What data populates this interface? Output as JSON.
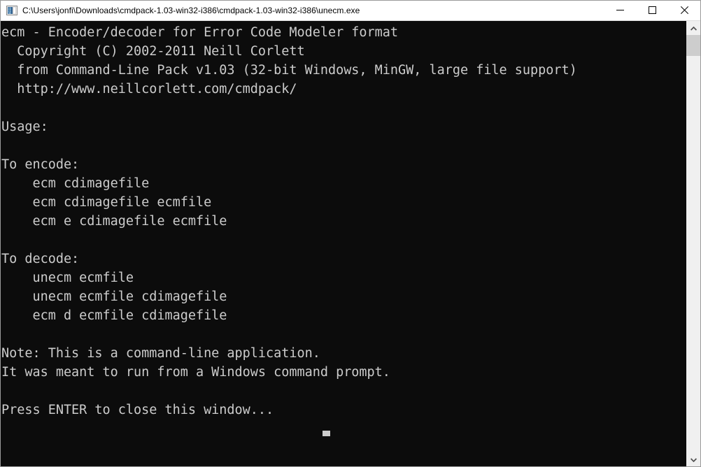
{
  "window": {
    "title": "C:\\Users\\jonfi\\Downloads\\cmdpack-1.03-win32-i386\\cmdpack-1.03-win32-i386\\unecm.exe",
    "icon": "console-app-icon",
    "controls": {
      "minimize": "minimize-icon",
      "maximize": "maximize-icon",
      "close": "close-icon"
    },
    "colors": {
      "titlebar_background": "#ffffff",
      "titlebar_text": "#000000",
      "console_background": "#0c0c0c",
      "console_text": "#cccccc",
      "scrollbar_track": "#f0f0f0",
      "scrollbar_thumb": "#cdcdcd",
      "window_border": "#9a9a9a"
    }
  },
  "console": {
    "lines": [
      "ecm - Encoder/decoder for Error Code Modeler format",
      "  Copyright (C) 2002-2011 Neill Corlett",
      "  from Command-Line Pack v1.03 (32-bit Windows, MinGW, large file support)",
      "  http://www.neillcorlett.com/cmdpack/",
      "",
      "Usage:",
      "",
      "To encode:",
      "    ecm cdimagefile",
      "    ecm cdimagefile ecmfile",
      "    ecm e cdimagefile ecmfile",
      "",
      "To decode:",
      "    unecm ecmfile",
      "    unecm ecmfile cdimagefile",
      "    ecm d ecmfile cdimagefile",
      "",
      "Note: This is a command-line application.",
      "It was meant to run from a Windows command prompt.",
      "",
      "Press ENTER to close this window..."
    ],
    "text": "ecm - Encoder/decoder for Error Code Modeler format\n  Copyright (C) 2002-2011 Neill Corlett\n  from Command-Line Pack v1.03 (32-bit Windows, MinGW, large file support)\n  http://www.neillcorlett.com/cmdpack/\n\nUsage:\n\nTo encode:\n    ecm cdimagefile\n    ecm cdimagefile ecmfile\n    ecm e cdimagefile ecmfile\n\nTo decode:\n    unecm ecmfile\n    unecm ecmfile cdimagefile\n    ecm d ecmfile cdimagefile\n\nNote: This is a command-line application.\nIt was meant to run from a Windows command prompt.\n\nPress ENTER to close this window...",
    "cursor": "text-cursor"
  },
  "scrollbar": {
    "up_arrow": "chevron-up-icon",
    "down_arrow": "chevron-down-icon",
    "thumb": "scrollbar-thumb"
  }
}
